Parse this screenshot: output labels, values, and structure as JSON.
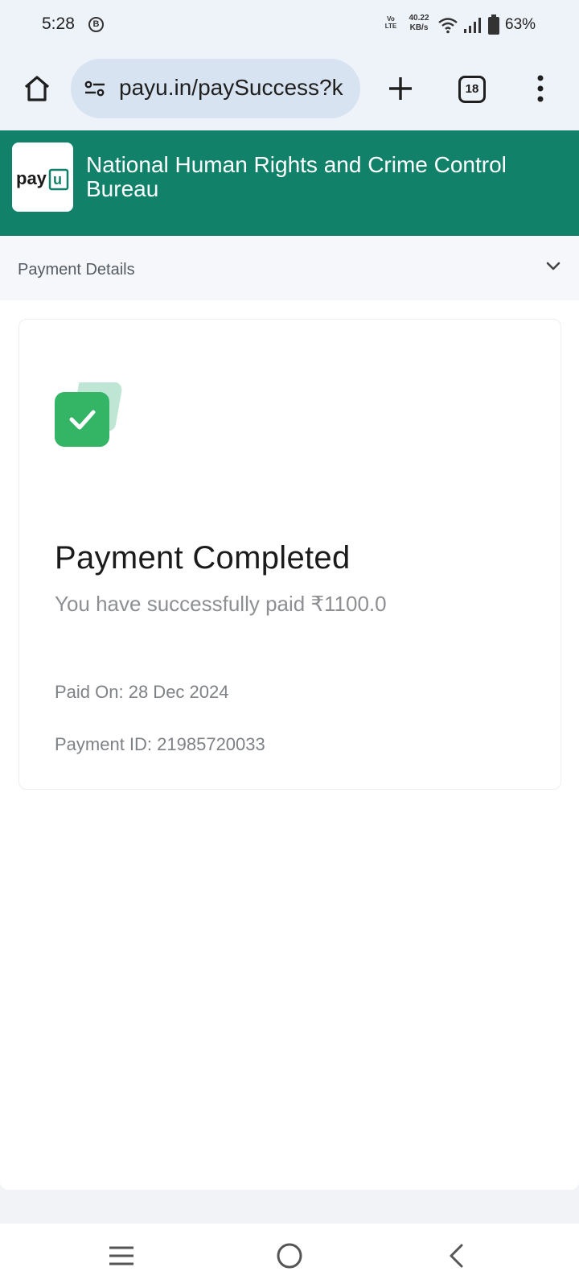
{
  "status_bar": {
    "time": "5:28",
    "b_badge": "B",
    "volte_line1": "Vo",
    "volte_line2": "LTE",
    "speed_value": "40.22",
    "speed_unit": "KB/s",
    "battery_percent": "63%"
  },
  "browser": {
    "url": "payu.in/paySuccess?k",
    "tab_count": "18",
    "icons": [
      "home-icon",
      "site-settings-icon",
      "plus-icon",
      "tabs-icon",
      "more-vert-icon"
    ]
  },
  "header": {
    "logo_text": "payu",
    "merchant_name": "National Human Rights and Crime Control Bureau",
    "background_color": "#12816a"
  },
  "payment_details": {
    "label": "Payment Details"
  },
  "success": {
    "title": "Payment Completed",
    "subtitle": "You have successfully paid ₹1100.0",
    "paid_on": "Paid On: 28 Dec 2024",
    "payment_id": "Payment ID: 21985720033",
    "accent_color": "#34b566"
  },
  "nav_bar": {
    "icons": [
      "menu-icon",
      "home-circle-icon",
      "back-icon"
    ]
  }
}
